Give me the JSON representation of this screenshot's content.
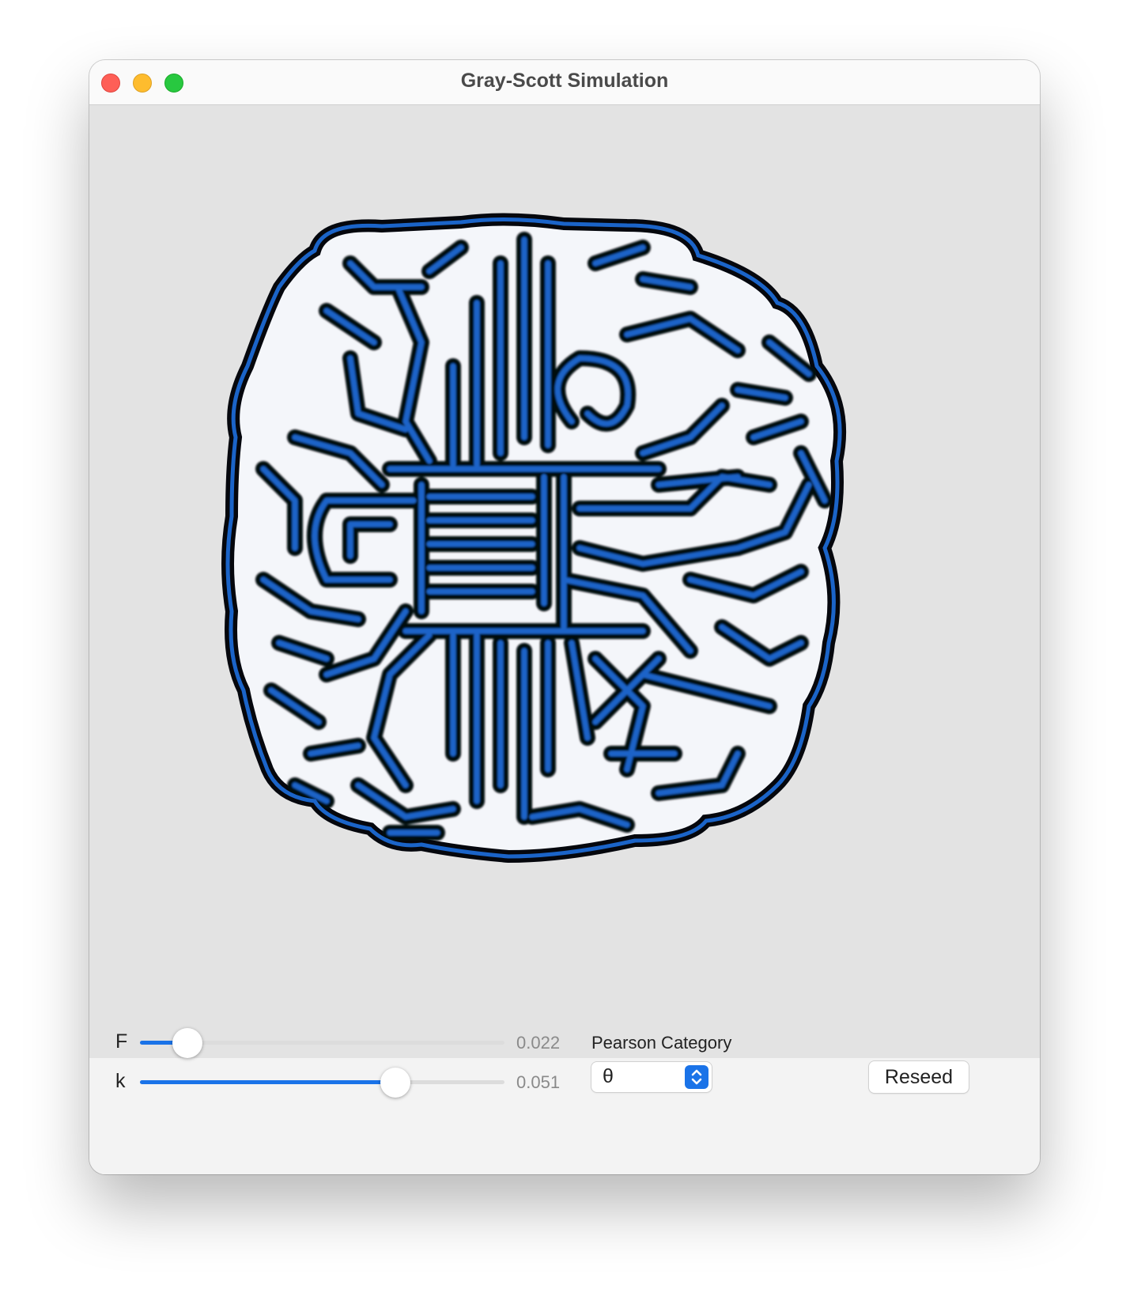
{
  "window": {
    "title": "Gray-Scott Simulation"
  },
  "controls": {
    "f_label": "F",
    "f_value": "0.022",
    "f_slider_fraction": 0.13,
    "k_label": "k",
    "k_value": "0.051",
    "k_slider_fraction": 0.7,
    "category_label": "Pearson Category",
    "category_selected": "θ",
    "reseed_label": "Reseed"
  },
  "colors": {
    "accent": "#1a73e8",
    "pattern_blue": "#1b64c8",
    "pattern_dark": "#05070d",
    "background": "#e3e3e3"
  },
  "icons": {
    "close": "close-dot-icon",
    "minimize": "minimize-dot-icon",
    "zoom": "zoom-dot-icon",
    "stepper": "chevron-up-down-icon"
  }
}
